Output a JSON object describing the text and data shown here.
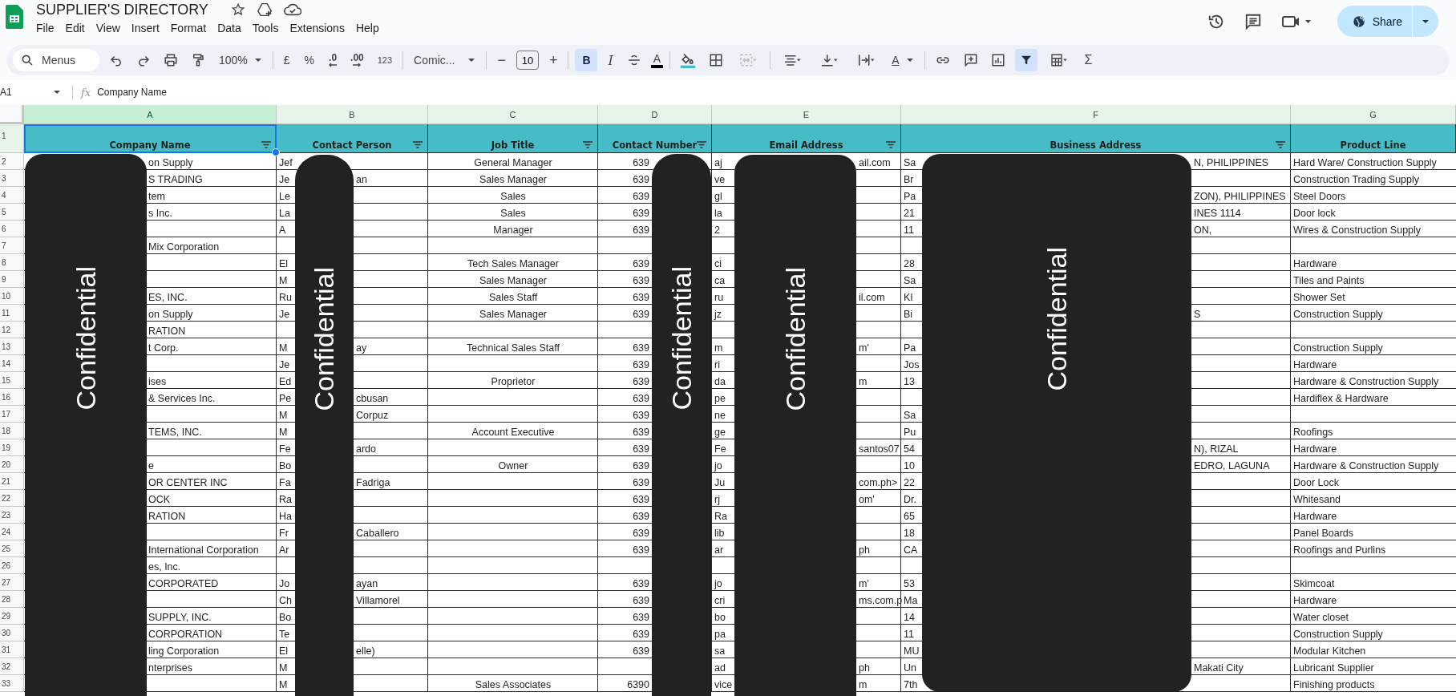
{
  "window": {
    "title": "SUPPLIER'S DIRECTORY"
  },
  "menu": [
    "File",
    "Edit",
    "View",
    "Insert",
    "Format",
    "Data",
    "Tools",
    "Extensions",
    "Help"
  ],
  "share": {
    "label": "Share"
  },
  "toolbar": {
    "search_placeholder": "Menus",
    "zoom": "100%",
    "currency": "£",
    "percent": "%",
    "decrease_decimals": ".0",
    "increase_decimals": ".00",
    "number_format": "123",
    "font": "Comic...",
    "minus": "−",
    "font_size": "10",
    "plus": "+",
    "bold": {
      "label": "B",
      "selected": true
    },
    "italic": "I",
    "text_color": "A",
    "rotate": "A",
    "filter": {
      "selected": true
    },
    "sum": "Σ"
  },
  "formula_bar": {
    "cell": "A1",
    "fx": "fx",
    "value": "Company Name"
  },
  "columns": [
    {
      "letter": "A",
      "label": "Company Name",
      "selected": true,
      "filter": true
    },
    {
      "letter": "B",
      "label": "Contact Person",
      "selected": false,
      "filter": true
    },
    {
      "letter": "C",
      "label": "Job Title",
      "selected": false,
      "filter": true
    },
    {
      "letter": "D",
      "label": "Contact Number",
      "selected": false,
      "filter": true
    },
    {
      "letter": "E",
      "label": "Email Address",
      "selected": false,
      "filter": true
    },
    {
      "letter": "F",
      "label": "Business Address",
      "selected": false,
      "filter": true
    },
    {
      "letter": "G",
      "label": "Product Line",
      "selected": false,
      "filter": false
    }
  ],
  "header_row": {
    "number": "1",
    "selected": true
  },
  "rows": [
    {
      "number": "2",
      "company": "on Supply",
      "person_head": "Jef",
      "job_title": "General Manager",
      "phone": "639",
      "email_head": "aj",
      "email_tail": "ail.com",
      "address_head": "Sa",
      "address_tail": "N, PHILIPPINES",
      "product_line": "Hard Ware/ Construction Supply"
    },
    {
      "number": "3",
      "company": "S TRADING",
      "person_head": "Je",
      "person_tail": "an",
      "job_title": "Sales Manager",
      "phone": "639",
      "email_head": "ve",
      "address_head": "Br",
      "product_line": "Construction Trading Supply"
    },
    {
      "number": "4",
      "company": "tem",
      "person_head": "Le",
      "job_title": "Sales",
      "phone": "639",
      "email_head": "gl",
      "address_head": "Pa",
      "address_tail": "ZON), PHILIPPINES",
      "product_line": "Steel Doors"
    },
    {
      "number": "5",
      "company": "s Inc.",
      "person_head": "La",
      "job_title": "Sales",
      "phone": "639",
      "email_head": "la",
      "address_head": "21",
      "address_tail": "INES 1114",
      "product_line": "Door lock"
    },
    {
      "number": "6",
      "person_head": "A",
      "job_title": "Manager",
      "phone": "639",
      "email_head": "2",
      "address_head": "11",
      "address_tail": "ON,",
      "product_line": "Wires & Construction Supply"
    },
    {
      "number": "7",
      "company": "Mix Corporation"
    },
    {
      "number": "8",
      "person_head": "El",
      "job_title": "Tech Sales Manager",
      "phone": "639",
      "email_head": "ci",
      "address_head": "28",
      "product_line": "Hardware"
    },
    {
      "number": "9",
      "person_head": "M",
      "job_title": "Sales Manager",
      "phone": "639",
      "email_head": "ca",
      "address_head": "Sa",
      "product_line": "Tiles and Paints"
    },
    {
      "number": "10",
      "company": "ES, INC.",
      "person_head": "Ru",
      "job_title": "Sales Staff",
      "phone": "639",
      "email_head": "ru",
      "email_tail": "il.com",
      "address_head": "KI",
      "product_line": "Shower Set"
    },
    {
      "number": "11",
      "company": "on Supply",
      "person_head": "Je",
      "job_title": "Sales Manager",
      "phone": "639",
      "email_head": "jz",
      "address_head": "Bi",
      "address_tail": "S",
      "product_line": "Construction Supply"
    },
    {
      "number": "12",
      "company": "RATION"
    },
    {
      "number": "13",
      "company": "t Corp.",
      "person_head": "M",
      "person_tail": "ay",
      "job_title": "Technical Sales Staff",
      "phone": "639",
      "email_head": "m",
      "email_tail": "m'",
      "address_head": "Pa",
      "product_line": "Construction Supply"
    },
    {
      "number": "14",
      "person_head": "Je",
      "phone": "639",
      "email_head": "ri",
      "address_head": "Jos",
      "product_line": "Hardware"
    },
    {
      "number": "15",
      "company": "ises",
      "person_head": "Ed",
      "job_title": "Proprietor",
      "phone": "639",
      "email_head": "da",
      "email_tail": "m",
      "address_head": "13",
      "product_line": "Hardware & Construction Supply"
    },
    {
      "number": "16",
      "company": "& Services Inc.",
      "person_head": "Pe",
      "person_tail": "cbusan",
      "phone": "639",
      "email_head": "pe",
      "product_line": "Hardiflex & Hardware"
    },
    {
      "number": "17",
      "person_head": "M",
      "person_tail": "Corpuz",
      "phone": "639",
      "email_head": "ne",
      "address_head": "Sa"
    },
    {
      "number": "18",
      "company": "TEMS, INC.",
      "person_head": "M",
      "job_title": "Account Executive",
      "phone": "639",
      "email_head": "ge",
      "address_head": "Pu",
      "product_line": "Roofings"
    },
    {
      "number": "19",
      "person_head": "Fe",
      "person_tail": "ardo",
      "phone": "639",
      "email_head": "Fe",
      "email_tail": "santos07",
      "address_head": "54",
      "address_tail": "N), RIZAL",
      "product_line": "Hardware"
    },
    {
      "number": "20",
      "company": "e",
      "person_head": "Bo",
      "job_title": "Owner",
      "phone": "639",
      "email_head": "jo",
      "address_head": "10",
      "address_tail": "EDRO, LAGUNA",
      "product_line": "Hardware & Construction Supply"
    },
    {
      "number": "21",
      "company": "OR CENTER INC",
      "person_head": "Fa",
      "person_tail": "Fadriga",
      "phone": "639",
      "email_head": "Ju",
      "email_tail": "com.ph>",
      "address_head": "22",
      "product_line": "Door Lock"
    },
    {
      "number": "22",
      "company": "OCK",
      "person_head": "Ra",
      "phone": "639",
      "email_head": "rj",
      "email_tail": "om'",
      "address_head": "Dr.",
      "product_line": "Whitesand"
    },
    {
      "number": "23",
      "company": "RATION",
      "person_head": "Ha",
      "phone": "639",
      "email_head": "Ra",
      "address_head": "65",
      "product_line": "Hardware"
    },
    {
      "number": "24",
      "person_head": "Fr",
      "person_tail": "Caballero",
      "phone": "639",
      "email_head": "lib",
      "address_head": "18",
      "product_line": "Panel Boards"
    },
    {
      "number": "25",
      "company": "International Corporation",
      "person_head": "Ar",
      "phone": "639",
      "email_head": "ar",
      "email_tail": "ph",
      "address_head": "CA",
      "product_line": "Roofings and Purlins"
    },
    {
      "number": "26",
      "company": "es, Inc."
    },
    {
      "number": "27",
      "company": "CORPORATED",
      "person_head": "Jo",
      "person_tail": "ayan",
      "phone": "639",
      "email_head": "jo",
      "email_tail": "m'",
      "address_head": "53",
      "product_line": "Skimcoat"
    },
    {
      "number": "28",
      "person_head": "Ch",
      "person_tail": "Villamorel",
      "phone": "639",
      "email_head": "cri",
      "email_tail": "ms.com.p",
      "address_head": "Ma",
      "product_line": "Hardware"
    },
    {
      "number": "29",
      "company": "SUPPLY, INC.",
      "person_head": "Bo",
      "phone": "639",
      "email_head": "bo",
      "address_head": "14",
      "product_line": "Water closet"
    },
    {
      "number": "30",
      "company": "CORPORATION",
      "person_head": "Te",
      "phone": "639",
      "email_head": "pa",
      "address_head": "11",
      "product_line": "Construction Supply"
    },
    {
      "number": "31",
      "company": "ling Corporation",
      "person_head": "El",
      "person_tail": "elle)",
      "phone": "639",
      "email_head": "sa",
      "address_head": "MU",
      "product_line": "Modular Kitchen"
    },
    {
      "number": "32",
      "company": "nterprises",
      "person_head": "M",
      "email_head": "ad",
      "email_tail": "ph",
      "address_head": "Un",
      "address_tail": "Makati City",
      "product_line": "Lubricant Supplier"
    },
    {
      "number": "33",
      "person_head": "M",
      "job_title": "Sales Associates",
      "phone": "6390",
      "email_head": "vice",
      "email_tail": "m",
      "address_head": "7th",
      "product_line": "Finishing products"
    }
  ],
  "redactions": [
    {
      "label": "Confidential"
    },
    {
      "label": "Confidential"
    },
    {
      "label": "Confidential"
    },
    {
      "label": "Confidential"
    },
    {
      "label": "Confidential"
    }
  ]
}
